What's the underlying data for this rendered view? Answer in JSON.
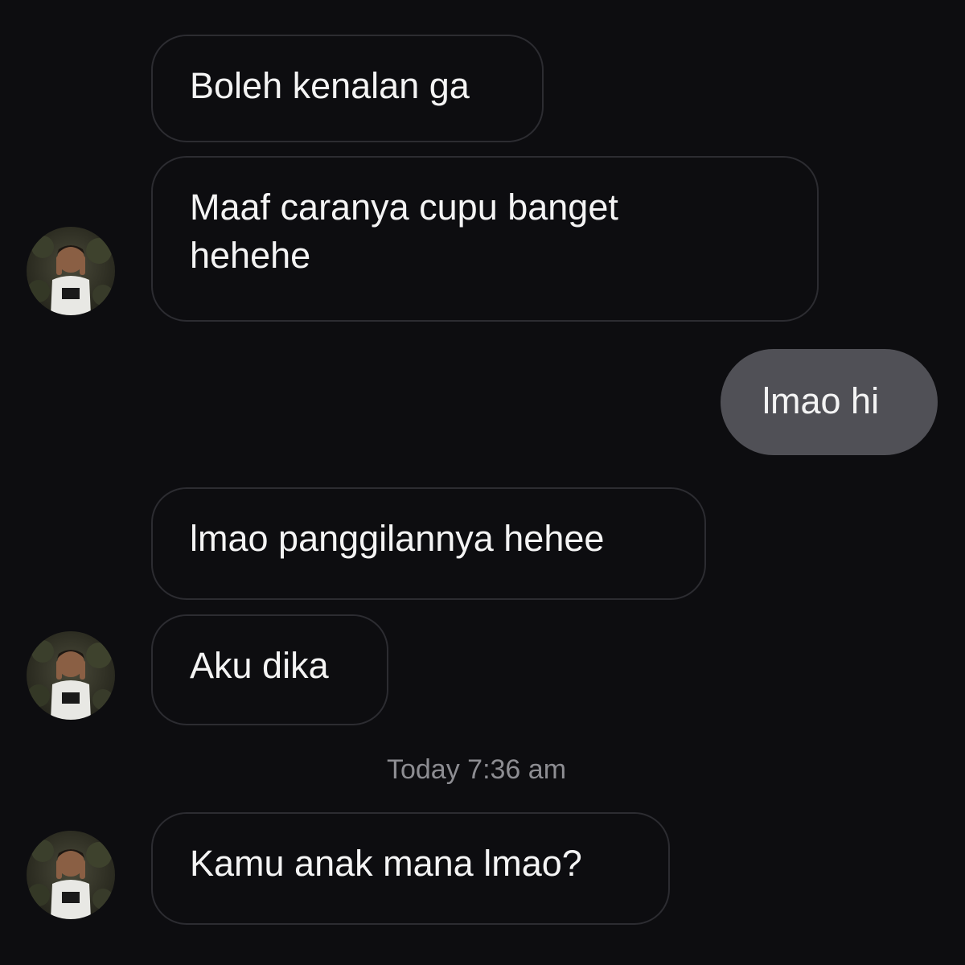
{
  "conversation": {
    "messages": [
      {
        "direction": "received",
        "text": "Boleh kenalan ga"
      },
      {
        "direction": "received",
        "text": "Maaf caranya cupu banget\nhehehe"
      },
      {
        "direction": "sent",
        "text": "lmao hi"
      },
      {
        "direction": "received",
        "text": "lmao panggilannya hehee"
      },
      {
        "direction": "received",
        "text": "Aku dika"
      },
      {
        "direction": "received",
        "text": "Kamu anak mana lmao?"
      }
    ],
    "timestamp": "Today 7:36 am"
  },
  "avatar": {
    "icon": "contact-avatar-icon"
  },
  "colors": {
    "background": "#0d0d10",
    "received_border": "#2c2c31",
    "sent_bubble": "#505056",
    "timestamp_text": "#8d8d92"
  }
}
